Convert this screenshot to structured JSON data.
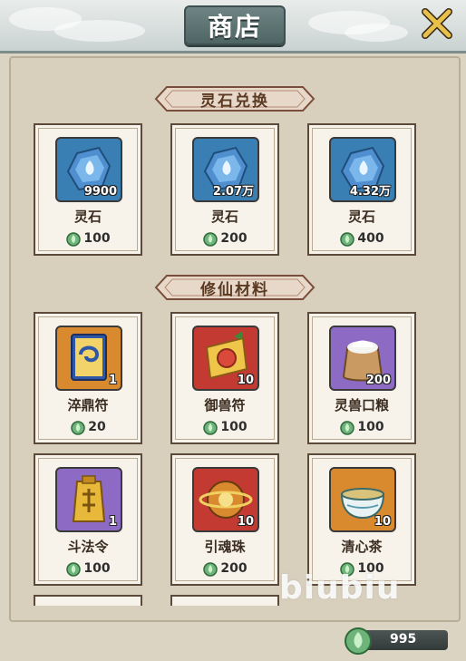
{
  "header": {
    "title": "商店"
  },
  "sections": [
    {
      "title": "灵石兑换",
      "items": [
        {
          "name": "灵石",
          "qty": "9900",
          "price": "100",
          "icon": "spirit-stone-icon"
        },
        {
          "name": "灵石",
          "qty": "2.07万",
          "price": "200",
          "icon": "spirit-stone-icon"
        },
        {
          "name": "灵石",
          "qty": "4.32万",
          "price": "400",
          "icon": "spirit-stone-icon"
        }
      ]
    },
    {
      "title": "修仙材料",
      "items": [
        {
          "name": "淬鼎符",
          "qty": "1",
          "price": "20",
          "icon": "talisman-scroll-icon"
        },
        {
          "name": "御兽符",
          "qty": "10",
          "price": "100",
          "icon": "beast-talisman-icon"
        },
        {
          "name": "灵兽口粮",
          "qty": "200",
          "price": "100",
          "icon": "food-sack-icon"
        },
        {
          "name": "斗法令",
          "qty": "1",
          "price": "100",
          "icon": "battle-token-icon"
        },
        {
          "name": "引魂珠",
          "qty": "10",
          "price": "200",
          "icon": "soul-orb-icon"
        },
        {
          "name": "清心茶",
          "qty": "10",
          "price": "100",
          "icon": "tea-bowl-icon"
        }
      ]
    }
  ],
  "balance": {
    "value": "995",
    "icon": "jade-currency-icon"
  },
  "watermark": "biubiu",
  "colors": {
    "panel": "#d8cfbc",
    "title_plate": "#5f7574",
    "card_border": "#5c4a3a",
    "banner": "#e7d8c9"
  }
}
